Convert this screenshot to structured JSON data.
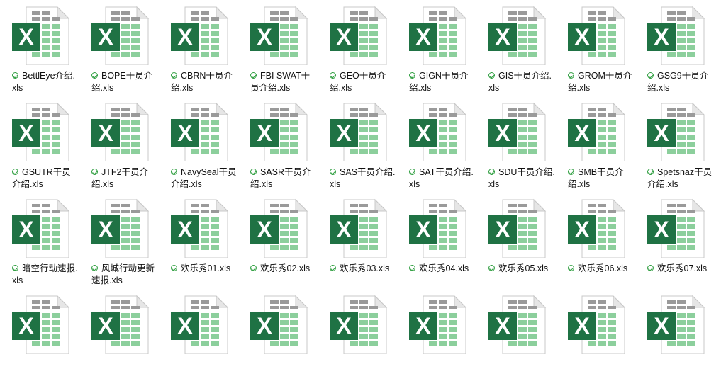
{
  "files": [
    {
      "name": "BettlEye介绍.xls"
    },
    {
      "name": "BOPE干员介绍.xls"
    },
    {
      "name": "CBRN干员介绍.xls"
    },
    {
      "name": "FBI SWAT干员介绍.xls"
    },
    {
      "name": "GEO干员介绍.xls"
    },
    {
      "name": "GIGN干员介绍.xls"
    },
    {
      "name": "GIS干员介绍.xls"
    },
    {
      "name": "GROM干员介绍.xls"
    },
    {
      "name": "GSG9干员介绍.xls"
    },
    {
      "name": "GSUTR干员介绍.xls"
    },
    {
      "name": "JTF2干员介绍.xls"
    },
    {
      "name": "NavySeal干员介绍.xls"
    },
    {
      "name": "SASR干员介绍.xls"
    },
    {
      "name": "SAS干员介绍.xls"
    },
    {
      "name": "SAT干员介绍.xls"
    },
    {
      "name": "SDU干员介绍.xls"
    },
    {
      "name": "SMB干员介绍.xls"
    },
    {
      "name": "Spetsnaz干员介绍.xls"
    },
    {
      "name": "暗空行动速报.xls"
    },
    {
      "name": "风城行动更新速报.xls"
    },
    {
      "name": "欢乐秀01.xls"
    },
    {
      "name": "欢乐秀02.xls"
    },
    {
      "name": "欢乐秀03.xls"
    },
    {
      "name": "欢乐秀04.xls"
    },
    {
      "name": "欢乐秀05.xls"
    },
    {
      "name": "欢乐秀06.xls"
    },
    {
      "name": "欢乐秀07.xls"
    },
    {
      "name": ""
    },
    {
      "name": ""
    },
    {
      "name": ""
    },
    {
      "name": ""
    },
    {
      "name": ""
    },
    {
      "name": ""
    },
    {
      "name": ""
    },
    {
      "name": ""
    },
    {
      "name": ""
    }
  ],
  "icon": "excel-file-icon",
  "status_icon": "synced-check-icon",
  "colors": {
    "excel_green": "#1f7244",
    "sheet_green": "#8ccf9c",
    "check_green": "#2e9e3f"
  }
}
